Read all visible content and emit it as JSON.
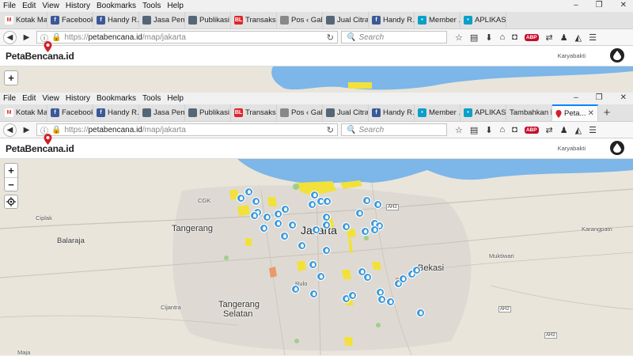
{
  "browser": {
    "menu": [
      "File",
      "Edit",
      "View",
      "History",
      "Bookmarks",
      "Tools",
      "Help"
    ],
    "menu_underline": [
      "F",
      "E",
      "V",
      "s",
      "B",
      "T",
      "H"
    ],
    "window_controls": [
      "–",
      "❐",
      "✕"
    ],
    "tabs_back": [
      {
        "label": "Kotak Ma...",
        "icon": "gmail-icon",
        "color": "#ffffff",
        "glyph": "M",
        "glyph_color": "#d93025"
      },
      {
        "label": "Facebook",
        "icon": "facebook-icon",
        "color": "#3b5998",
        "glyph": "f"
      },
      {
        "label": "Handy R...",
        "icon": "facebook-icon",
        "color": "#3b5998",
        "glyph": "f"
      },
      {
        "label": "Jasa Pem...",
        "icon": "globe-icon",
        "color": "#556677",
        "glyph": ""
      },
      {
        "label": "Publikasi ...",
        "icon": "globe-icon",
        "color": "#556677",
        "glyph": ""
      },
      {
        "label": "Transaksi...",
        "icon": "bl-icon",
        "color": "#e0242a",
        "glyph": "BL"
      },
      {
        "label": "Pos ‹ Galerigi...",
        "icon": "wordpress-icon",
        "color": "#888888",
        "glyph": ""
      },
      {
        "label": "Jual Citra ...",
        "icon": "globe-icon",
        "color": "#556677",
        "glyph": ""
      },
      {
        "label": "Handy R...",
        "icon": "facebook-icon",
        "color": "#3b5998",
        "glyph": "f"
      },
      {
        "label": "Member ...",
        "icon": "member-icon",
        "color": "#0aa0c8",
        "glyph": "•"
      },
      {
        "label": "APLIKASI ...",
        "icon": "member-icon",
        "color": "#0aa0c8",
        "glyph": "•"
      }
    ],
    "tabs_front": [
      {
        "label": "Kotak Ma...",
        "icon": "gmail-icon",
        "color": "#ffffff",
        "glyph": "M",
        "glyph_color": "#d93025"
      },
      {
        "label": "Facebook",
        "icon": "facebook-icon",
        "color": "#3b5998",
        "glyph": "f"
      },
      {
        "label": "Handy R...",
        "icon": "facebook-icon",
        "color": "#3b5998",
        "glyph": "f"
      },
      {
        "label": "Jasa Pem...",
        "icon": "globe-icon",
        "color": "#556677",
        "glyph": ""
      },
      {
        "label": "Publikasi ...",
        "icon": "globe-icon",
        "color": "#556677",
        "glyph": ""
      },
      {
        "label": "Transaksi...",
        "icon": "bl-icon",
        "color": "#e0242a",
        "glyph": "BL"
      },
      {
        "label": "Pos ‹ Galerigi...",
        "icon": "wordpress-icon",
        "color": "#888888",
        "glyph": ""
      },
      {
        "label": "Jual Citra ...",
        "icon": "globe-icon",
        "color": "#556677",
        "glyph": ""
      },
      {
        "label": "Handy R...",
        "icon": "facebook-icon",
        "color": "#3b5998",
        "glyph": "f"
      },
      {
        "label": "Member ...",
        "icon": "member-icon",
        "color": "#0aa0c8",
        "glyph": "•"
      },
      {
        "label": "APLIKASI ...",
        "icon": "member-icon",
        "color": "#0aa0c8",
        "glyph": "•"
      },
      {
        "label": "Tambahkan P...",
        "icon": "none",
        "color": "",
        "glyph": ""
      }
    ],
    "active_tab_label": "Peta...",
    "url_protocol": "https://",
    "url_domain": "petabencana.id",
    "url_path": "/map/jakarta",
    "search_placeholder": "Search"
  },
  "site": {
    "logo_text": "PetaBencana",
    "logo_suffix": ".id",
    "brand_red": "#d0202a"
  },
  "map": {
    "zoom_in": "+",
    "zoom_out": "−",
    "marker_color": "#3d9bdc",
    "water_color": "#7db6e8",
    "flood_zone_color": "#f2e13b",
    "places": {
      "karyabakti": "Karyabakti",
      "cgk": "CGK",
      "tangerang": "Tangerang",
      "ciplak": "Ciplak",
      "balaraja": "Balaraja",
      "jakarta": "Jakarta",
      "bekasi": "Bekasi",
      "karangpatri": "Karangpatri",
      "muktiwari": "Muktiwari",
      "rulo": "Rulo",
      "cijantra": "Cijantra",
      "tangerang_selatan_1": "Tangerang",
      "tangerang_selatan_2": "Selatan",
      "maja": "Maja",
      "ah2_a": "AH2",
      "ah2_b": "AH2",
      "ah2_c": "AH2"
    }
  }
}
